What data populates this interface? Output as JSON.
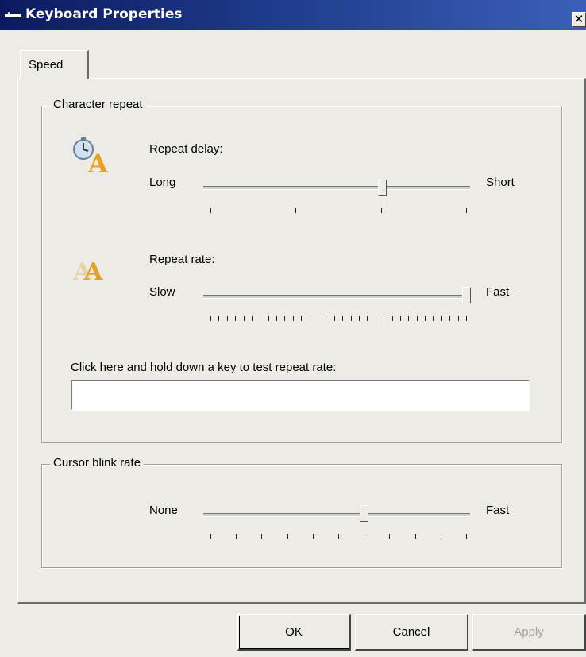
{
  "window": {
    "title": "Keyboard Properties",
    "close_label": "✕",
    "title_icon": "keyboard-icon"
  },
  "tabs": [
    {
      "label": "Speed",
      "selected": true
    }
  ],
  "character_repeat": {
    "group_label": "Character repeat",
    "repeat_delay": {
      "label": "Repeat delay:",
      "min_label": "Long",
      "max_label": "Short",
      "icon": "stopwatch-letter-icon",
      "ticks": 4,
      "value_fraction": 0.67
    },
    "repeat_rate": {
      "label": "Repeat rate:",
      "min_label": "Slow",
      "max_label": "Fast",
      "icon": "double-letter-icon",
      "ticks": 32,
      "value_fraction": 1.0
    },
    "test_label": "Click here and hold down a key to test repeat rate:",
    "test_value": ""
  },
  "cursor_blink": {
    "group_label": "Cursor blink rate",
    "min_label": "None",
    "max_label": "Fast",
    "ticks": 11,
    "value_fraction": 0.6
  },
  "buttons": {
    "ok": "OK",
    "cancel": "Cancel",
    "apply": "Apply"
  },
  "colors": {
    "titlebar_dark": "#0b1a5e",
    "titlebar_light": "#3b5fb8",
    "face": "#ecebe6",
    "icon_gold": "#e8a020"
  }
}
